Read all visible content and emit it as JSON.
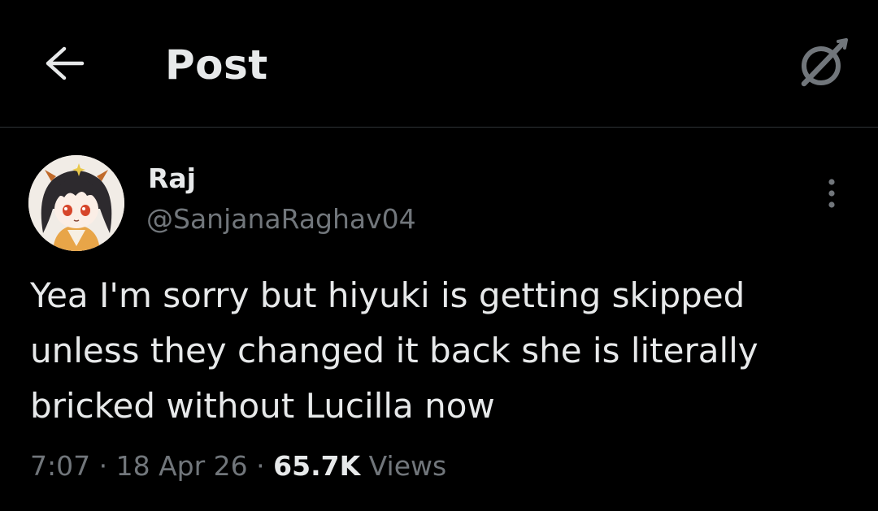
{
  "header": {
    "title": "Post",
    "back_icon": "arrow-left-icon",
    "action_icon": "grok-icon"
  },
  "post": {
    "author": {
      "name": "Raj",
      "handle": "@SanjanaRaghav04"
    },
    "text": "Yea I'm sorry but hiyuki is getting skipped\nunless they changed it back she is literally\nbricked without Lucilla now",
    "time": "7:07",
    "separator": "·",
    "date": "18 Apr 26",
    "views_count": "65.7K",
    "views_label": "Views",
    "more_icon": "more-vertical-icon"
  },
  "colors": {
    "background": "#000000",
    "text_primary": "#e7e9ea",
    "text_secondary": "#71767b",
    "divider": "#2f3336"
  }
}
